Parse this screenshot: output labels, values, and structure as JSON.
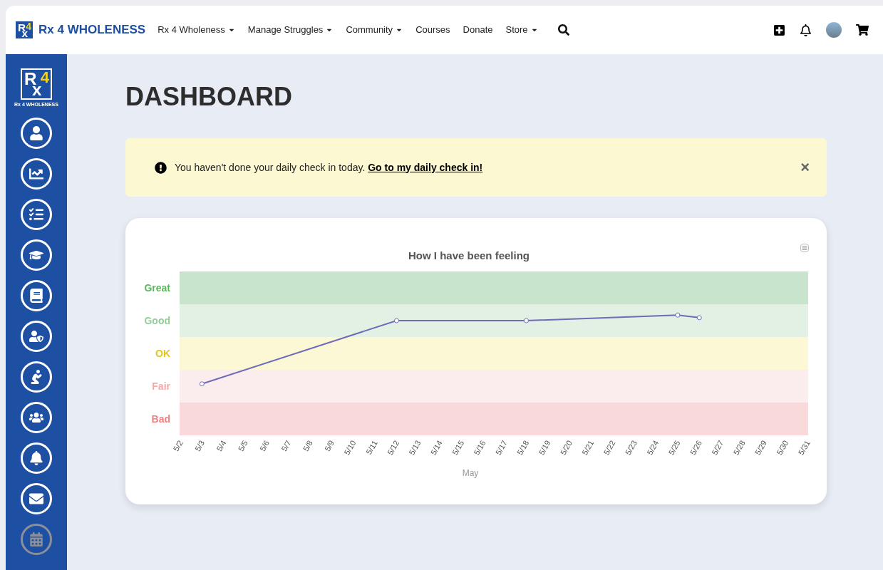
{
  "navbar": {
    "brand": {
      "letters": [
        "R",
        "x",
        "4"
      ],
      "name": "Rx 4 WHOLENESS"
    },
    "items": [
      {
        "label": "Rx 4 Wholeness",
        "dropdown": true
      },
      {
        "label": "Manage Struggles",
        "dropdown": true
      },
      {
        "label": "Community",
        "dropdown": true
      },
      {
        "label": "Courses",
        "dropdown": false
      },
      {
        "label": "Donate",
        "dropdown": false
      },
      {
        "label": "Store",
        "dropdown": true
      }
    ]
  },
  "sidebar": {
    "logo": {
      "letters": [
        "R",
        "x",
        "4"
      ],
      "caption": "Rx 4 WHOLENESS"
    },
    "items": [
      {
        "disabled": false
      },
      {
        "disabled": false
      },
      {
        "disabled": false
      },
      {
        "disabled": false
      },
      {
        "disabled": false
      },
      {
        "disabled": false
      },
      {
        "disabled": false
      },
      {
        "disabled": false
      },
      {
        "disabled": false
      },
      {
        "disabled": false
      },
      {
        "disabled": true
      }
    ]
  },
  "page": {
    "title": "DASHBOARD"
  },
  "alert": {
    "text": "You haven't done your daily check in today.",
    "link": "Go to my daily check in!",
    "close": "×"
  },
  "feeling_chart": {
    "title": "How I have been feeling",
    "y_labels": [
      {
        "label": "Great",
        "color": "#5cb85c"
      },
      {
        "label": "Good",
        "color": "#94cc97"
      },
      {
        "label": "OK",
        "color": "#e3c520"
      },
      {
        "label": "Fair",
        "color": "#f4a9a9"
      },
      {
        "label": "Bad",
        "color": "#f08080"
      }
    ],
    "bands": [
      {
        "color": "#c8e4cd"
      },
      {
        "color": "#e3f1e4"
      },
      {
        "color": "#fcf8d6"
      },
      {
        "color": "#fbeced"
      },
      {
        "color": "#f9d9da"
      }
    ],
    "x_labels": [
      "5/2",
      "5/3",
      "5/4",
      "5/5",
      "5/6",
      "5/7",
      "5/8",
      "5/9",
      "5/10",
      "5/11",
      "5/12",
      "5/13",
      "5/14",
      "5/15",
      "5/16",
      "5/17",
      "5/18",
      "5/19",
      "5/20",
      "5/21",
      "5/22",
      "5/23",
      "5/24",
      "5/25",
      "5/26",
      "5/27",
      "5/28",
      "5/29",
      "5/30",
      "5/31"
    ],
    "xlabel": "May"
  }
}
